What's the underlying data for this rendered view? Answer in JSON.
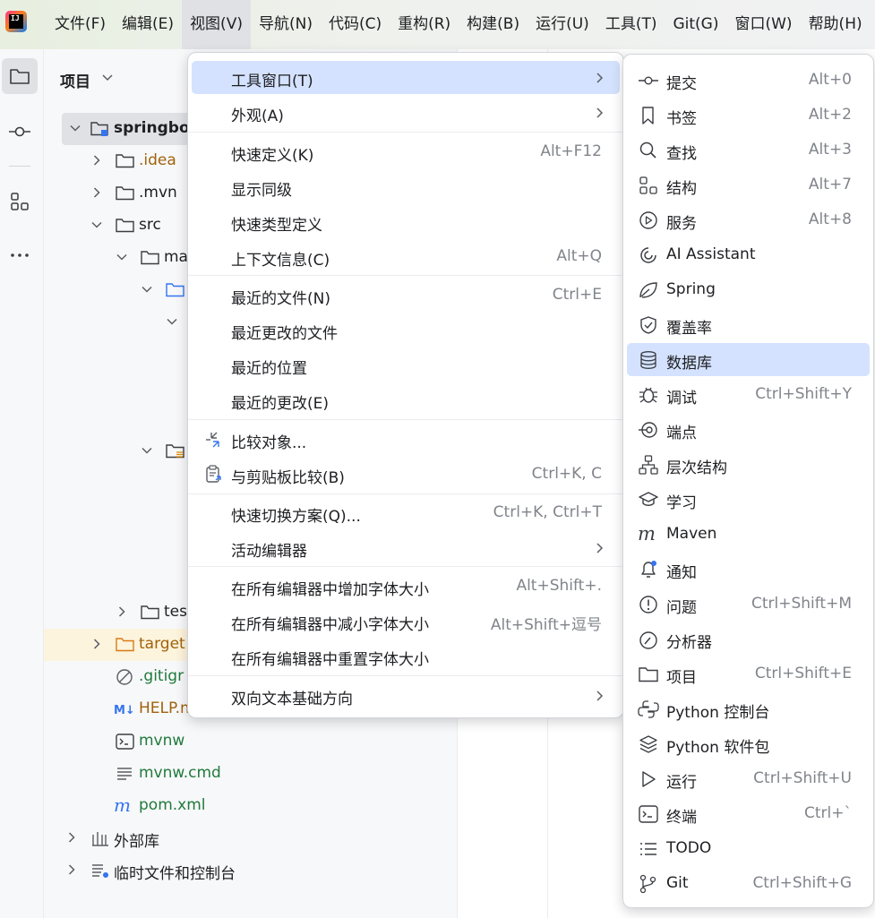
{
  "menubar": {
    "items": [
      "文件(F)",
      "编辑(E)",
      "视图(V)",
      "导航(N)",
      "代码(C)",
      "重构(R)",
      "构建(B)",
      "运行(U)",
      "工具(T)",
      "Git(G)",
      "窗口(W)",
      "帮助(H)"
    ],
    "logo_text": "IJ"
  },
  "project_panel": {
    "title": "项目",
    "tree": [
      {
        "label": "springbo",
        "style": "bold"
      },
      {
        "label": ".idea",
        "style": "orange"
      },
      {
        "label": ".mvn",
        "style": ""
      },
      {
        "label": "src",
        "style": ""
      },
      {
        "label": "ma",
        "style": ""
      },
      {
        "label": "tes",
        "style": ""
      },
      {
        "label": "target",
        "style": "orange"
      },
      {
        "label": ".gitigr",
        "style": "green"
      },
      {
        "label": "HELP.m",
        "style": "orange"
      },
      {
        "label": "mvnw",
        "style": "green"
      },
      {
        "label": "mvnw.cmd",
        "style": "green"
      },
      {
        "label": "pom.xml",
        "style": "green"
      },
      {
        "label": "外部库",
        "style": ""
      },
      {
        "label": "临时文件和控制台",
        "style": ""
      }
    ]
  },
  "view_menu": {
    "items": [
      {
        "label": "工具窗口(T)",
        "shortcut": ""
      },
      {
        "label": "外观(A)",
        "shortcut": ""
      },
      {
        "label": "快速定义(K)",
        "shortcut": "Alt+F12"
      },
      {
        "label": "显示同级",
        "shortcut": ""
      },
      {
        "label": "快速类型定义",
        "shortcut": ""
      },
      {
        "label": "上下文信息(C)",
        "shortcut": "Alt+Q"
      },
      {
        "label": "最近的文件(N)",
        "shortcut": "Ctrl+E"
      },
      {
        "label": "最近更改的文件",
        "shortcut": ""
      },
      {
        "label": "最近的位置",
        "shortcut": ""
      },
      {
        "label": "最近的更改(E)",
        "shortcut": ""
      },
      {
        "label": "比较对象...",
        "shortcut": ""
      },
      {
        "label": "与剪贴板比较(B)",
        "shortcut": "Ctrl+K, C"
      },
      {
        "label": "快速切换方案(Q)...",
        "shortcut": "Ctrl+K, Ctrl+T"
      },
      {
        "label": "活动编辑器",
        "shortcut": ""
      },
      {
        "label": "在所有编辑器中增加字体大小",
        "shortcut": "Alt+Shift+."
      },
      {
        "label": "在所有编辑器中减小字体大小",
        "shortcut": "Alt+Shift+逗号"
      },
      {
        "label": "在所有编辑器中重置字体大小",
        "shortcut": ""
      },
      {
        "label": "双向文本基础方向",
        "shortcut": ""
      }
    ]
  },
  "tool_windows_submenu": {
    "items": [
      {
        "label": "提交",
        "shortcut": "Alt+0",
        "icon": "commit-icon"
      },
      {
        "label": "书签",
        "shortcut": "Alt+2",
        "icon": "bookmark-icon"
      },
      {
        "label": "查找",
        "shortcut": "Alt+3",
        "icon": "search-icon"
      },
      {
        "label": "结构",
        "shortcut": "Alt+7",
        "icon": "structure-icon"
      },
      {
        "label": "服务",
        "shortcut": "Alt+8",
        "icon": "services-icon"
      },
      {
        "label": "AI Assistant",
        "shortcut": "",
        "icon": "ai-assistant-icon"
      },
      {
        "label": "Spring",
        "shortcut": "",
        "icon": "spring-leaf-icon"
      },
      {
        "label": "覆盖率",
        "shortcut": "",
        "icon": "coverage-shield-icon"
      },
      {
        "label": "数据库",
        "shortcut": "",
        "icon": "database-icon"
      },
      {
        "label": "调试",
        "shortcut": "Ctrl+Shift+Y",
        "icon": "debug-bug-icon"
      },
      {
        "label": "端点",
        "shortcut": "",
        "icon": "endpoints-icon"
      },
      {
        "label": "层次结构",
        "shortcut": "",
        "icon": "hierarchy-icon"
      },
      {
        "label": "学习",
        "shortcut": "",
        "icon": "learn-cap-icon"
      },
      {
        "label": "Maven",
        "shortcut": "",
        "icon": "maven-icon"
      },
      {
        "label": "通知",
        "shortcut": "",
        "icon": "notification-bell-icon"
      },
      {
        "label": "问题",
        "shortcut": "Ctrl+Shift+M",
        "icon": "problems-icon"
      },
      {
        "label": "分析器",
        "shortcut": "",
        "icon": "profiler-gauge-icon"
      },
      {
        "label": "项目",
        "shortcut": "Ctrl+Shift+E",
        "icon": "project-folder-icon"
      },
      {
        "label": "Python 控制台",
        "shortcut": "",
        "icon": "python-console-icon"
      },
      {
        "label": "Python 软件包",
        "shortcut": "",
        "icon": "python-packages-icon"
      },
      {
        "label": "运行",
        "shortcut": "Ctrl+Shift+U",
        "icon": "run-icon"
      },
      {
        "label": "终端",
        "shortcut": "Ctrl+`",
        "icon": "terminal-icon"
      },
      {
        "label": "TODO",
        "shortcut": "",
        "icon": "todo-list-icon"
      },
      {
        "label": "Git",
        "shortcut": "Ctrl+Shift+G",
        "icon": "git-branch-icon"
      }
    ]
  },
  "colors": {
    "accent": "#3574f0",
    "hover": "#d4e2ff",
    "shortcut": "#81848b"
  }
}
